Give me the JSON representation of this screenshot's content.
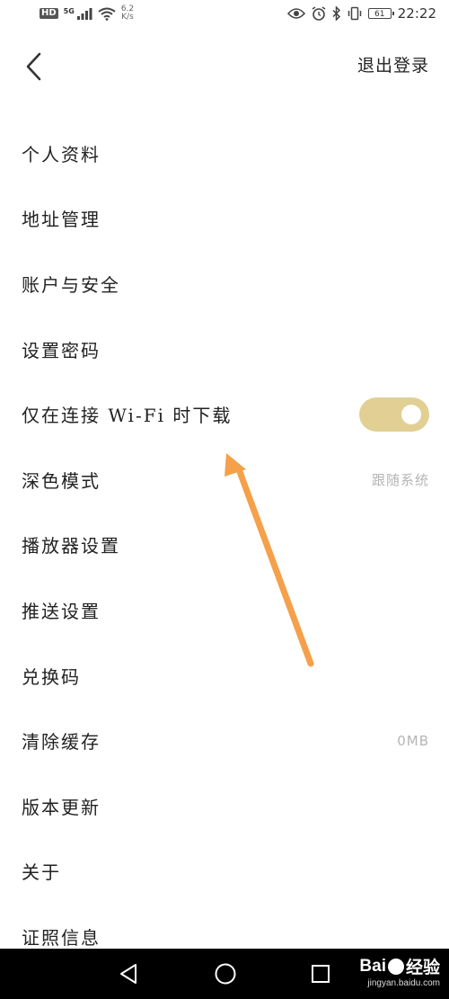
{
  "status_bar": {
    "hd_badge": "HD",
    "signal_gen": "5G",
    "net_speed_value": "6.2",
    "net_speed_unit": "K/s",
    "battery_level": "61",
    "time": "22:22"
  },
  "header": {
    "logout_label": "退出登录"
  },
  "settings": [
    {
      "label": "个人资料"
    },
    {
      "label": "地址管理"
    },
    {
      "label": "账户与安全"
    },
    {
      "label": "设置密码"
    },
    {
      "label": "仅在连接 Wi-Fi 时下载",
      "toggle_on": true
    },
    {
      "label": "深色模式",
      "value": "跟随系统"
    },
    {
      "label": "播放器设置"
    },
    {
      "label": "推送设置"
    },
    {
      "label": "兑换码"
    },
    {
      "label": "清除缓存",
      "value": "0MB"
    },
    {
      "label": "版本更新"
    },
    {
      "label": "关于"
    },
    {
      "label": "证照信息"
    }
  ],
  "watermark": {
    "brand": "Bai",
    "brand_suffix": "经验",
    "url": "jingyan.baidu.com"
  },
  "colors": {
    "toggle_on": "#e2cf94",
    "annotation_arrow": "#f5a04a",
    "secondary_text": "#b5b5b5"
  },
  "icons": [
    "back-arrow-icon",
    "nav-back-icon",
    "nav-home-icon",
    "nav-recent-icon",
    "eye-icon",
    "alarm-icon",
    "bluetooth-icon",
    "vibrate-icon",
    "wifi-icon",
    "signal-icon"
  ]
}
